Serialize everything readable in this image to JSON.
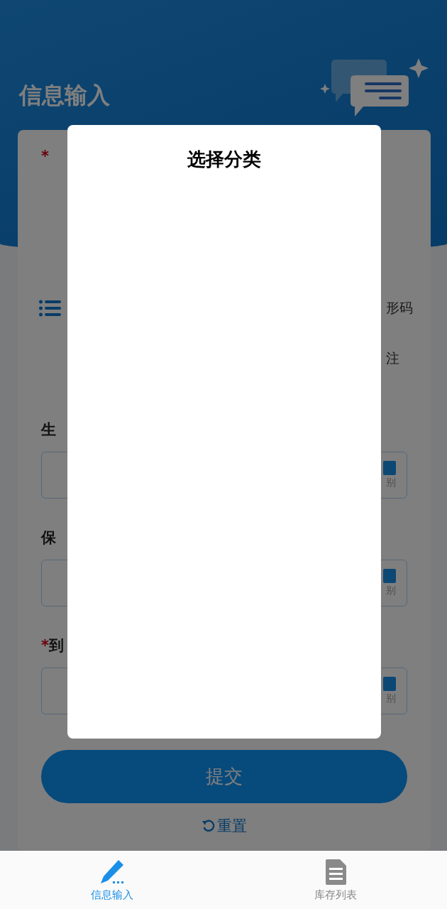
{
  "header": {
    "title": "信息输入"
  },
  "name_field": {
    "required_mark": "*"
  },
  "category_row": {
    "right_text": "形码"
  },
  "remark_row": {
    "right_text": "注"
  },
  "date_fields": [
    {
      "label": "生",
      "scan_label": "别"
    },
    {
      "label": "保",
      "scan_label": "别"
    },
    {
      "required_mark": "*",
      "label": "到",
      "scan_label": "别"
    }
  ],
  "submit": {
    "label": "提交"
  },
  "reset": {
    "label": "重置"
  },
  "dialog": {
    "title": "选择分类"
  },
  "tabbar": [
    {
      "label": "信息输入",
      "kind": "pencil",
      "selected": true
    },
    {
      "label": "库存列表",
      "kind": "document",
      "selected": false
    }
  ]
}
